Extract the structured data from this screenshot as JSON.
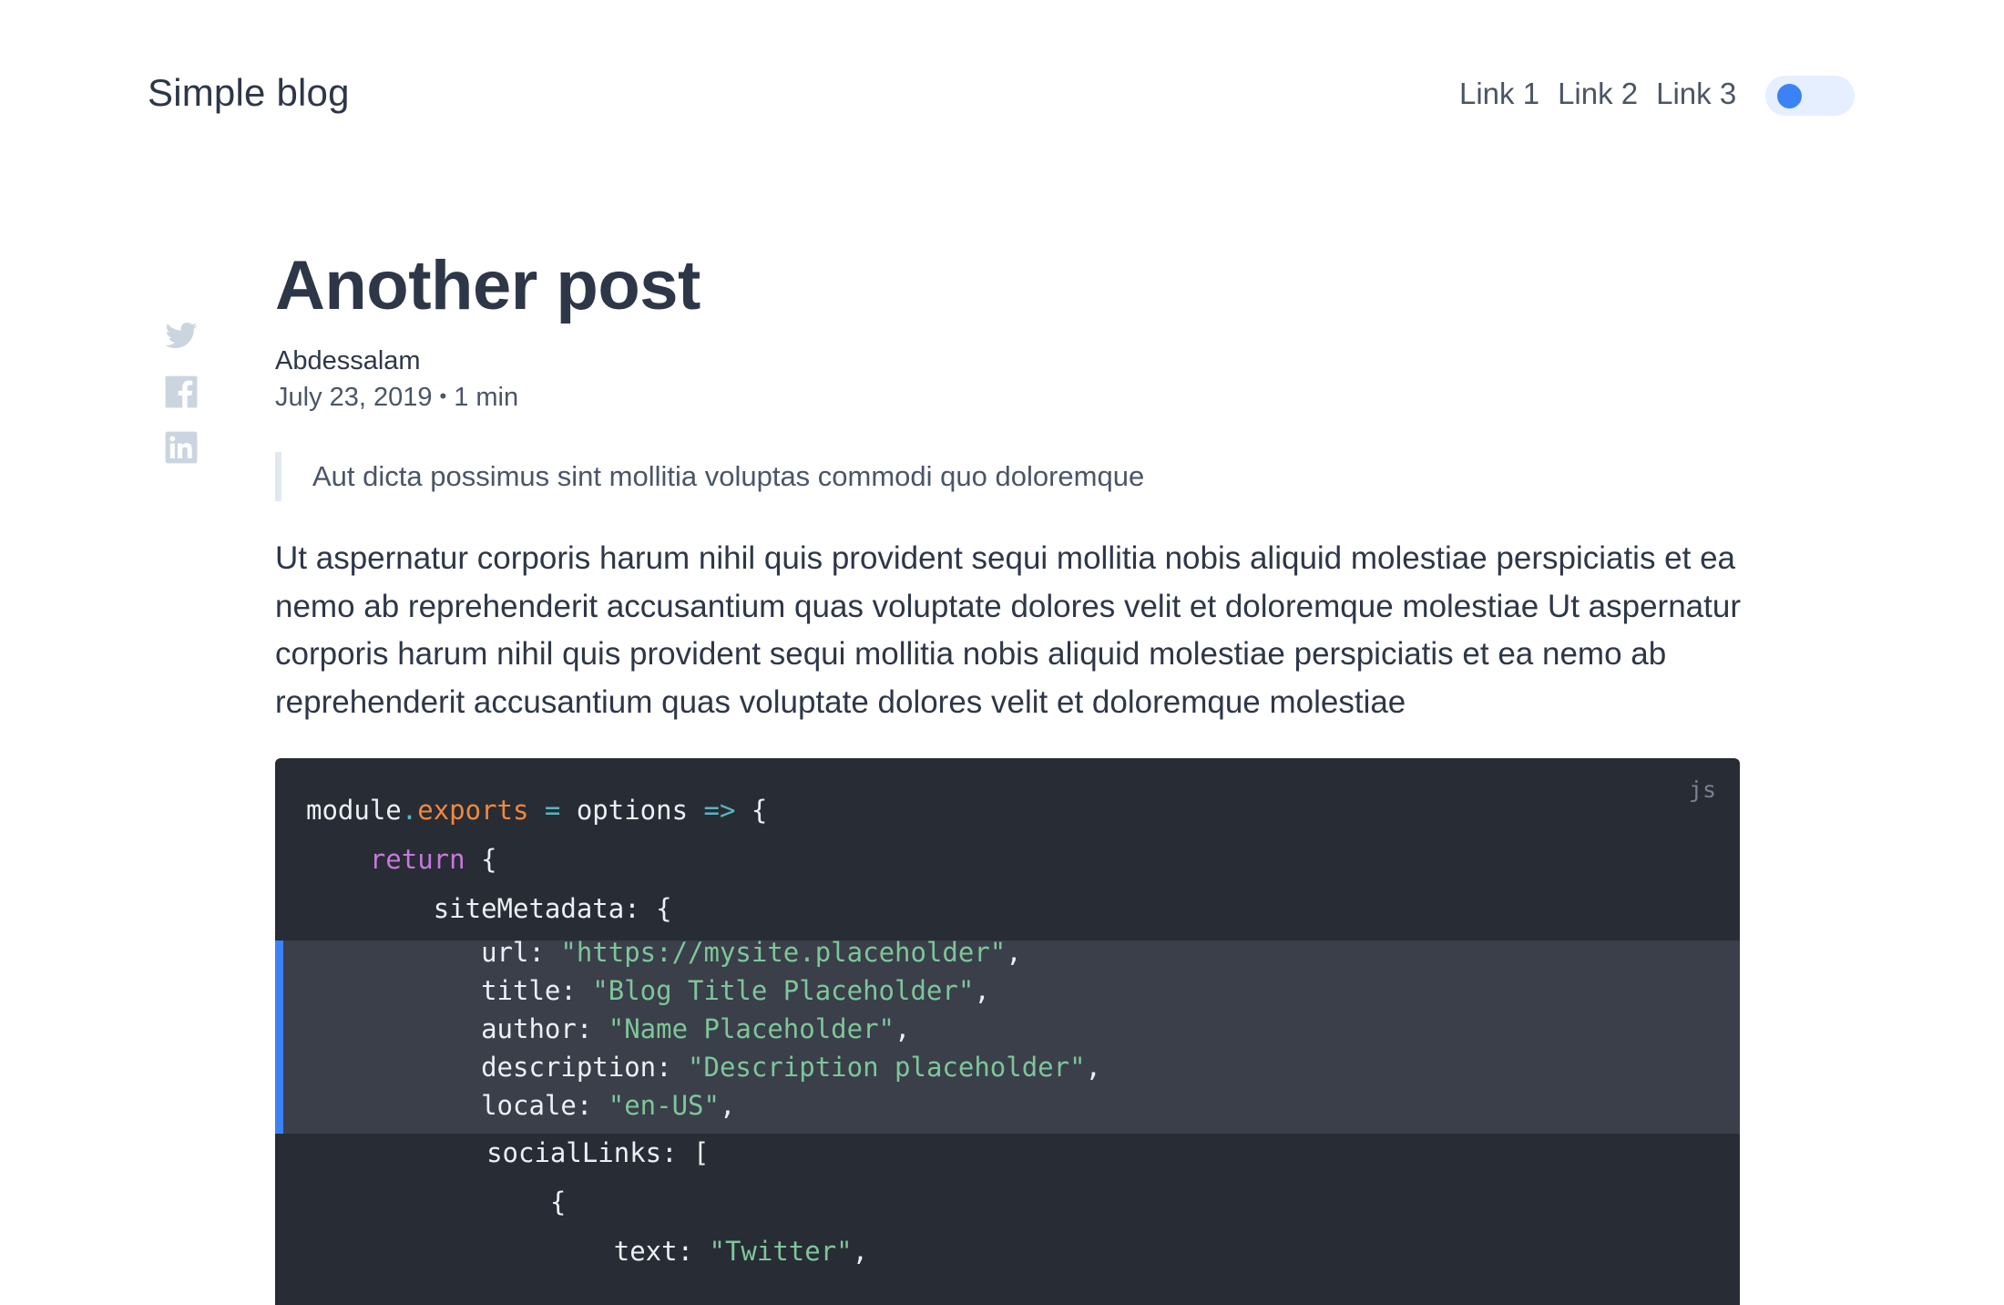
{
  "header": {
    "site_title": "Simple blog",
    "nav": [
      "Link 1",
      "Link 2",
      "Link 3"
    ],
    "accent_color": "#3b82f6"
  },
  "share": {
    "icons": [
      "twitter-icon",
      "facebook-icon",
      "linkedin-icon"
    ]
  },
  "post": {
    "title": "Another post",
    "author": "Abdessalam",
    "date": "July 23, 2019",
    "separator": "•",
    "read_time": "1 min",
    "quote": "Aut dicta possimus sint mollitia voluptas commodi quo doloremque",
    "body": "Ut aspernatur corporis harum nihil quis provident sequi mollitia nobis aliquid molestiae perspiciatis et ea nemo ab reprehenderit accusantium quas voluptate dolores velit et doloremque molestiae Ut aspernatur corporis harum nihil quis provident sequi mollitia nobis aliquid molestiae perspiciatis et ea nemo ab reprehenderit accusantium quas voluptate dolores velit et doloremque molestiae"
  },
  "code": {
    "language": "js",
    "lines": [
      {
        "indent": "",
        "tokens": [
          [
            "txt",
            "module"
          ],
          [
            "op",
            "."
          ],
          [
            "prop",
            "exports"
          ],
          [
            "op",
            " = "
          ],
          [
            "txt",
            "options "
          ],
          [
            "op",
            "=>"
          ],
          [
            "txt",
            " {"
          ]
        ]
      },
      {
        "indent": "    ",
        "tokens": [
          [
            "kw",
            "return"
          ],
          [
            "txt",
            " {"
          ]
        ]
      },
      {
        "indent": "        ",
        "tokens": [
          [
            "txt",
            "siteMetadata: {"
          ]
        ]
      },
      {
        "indent": "           ",
        "highlight": true,
        "tokens": [
          [
            "txt",
            "url: "
          ],
          [
            "str",
            "\"https://mysite.placeholder\""
          ],
          [
            "txt",
            ","
          ]
        ]
      },
      {
        "indent": "           ",
        "highlight": true,
        "tokens": [
          [
            "txt",
            "title: "
          ],
          [
            "str",
            "\"Blog Title Placeholder\""
          ],
          [
            "txt",
            ","
          ]
        ]
      },
      {
        "indent": "           ",
        "highlight": true,
        "tokens": [
          [
            "txt",
            "author: "
          ],
          [
            "str",
            "\"Name Placeholder\""
          ],
          [
            "txt",
            ","
          ]
        ]
      },
      {
        "indent": "           ",
        "highlight": true,
        "tokens": [
          [
            "txt",
            "description: "
          ],
          [
            "str",
            "\"Description placeholder\""
          ],
          [
            "txt",
            ","
          ]
        ]
      },
      {
        "indent": "           ",
        "highlight": true,
        "tokens": [
          [
            "txt",
            "locale: "
          ],
          [
            "str",
            "\"en-US\""
          ],
          [
            "txt",
            ","
          ]
        ]
      },
      {
        "indent": "           ",
        "tokens": [
          [
            "txt",
            "socialLinks: ["
          ]
        ]
      },
      {
        "indent": "               ",
        "tokens": [
          [
            "txt",
            "{"
          ]
        ]
      },
      {
        "indent": "                   ",
        "tokens": [
          [
            "txt",
            "text: "
          ],
          [
            "str",
            "\"Twitter\""
          ],
          [
            "txt",
            ","
          ]
        ]
      }
    ]
  }
}
